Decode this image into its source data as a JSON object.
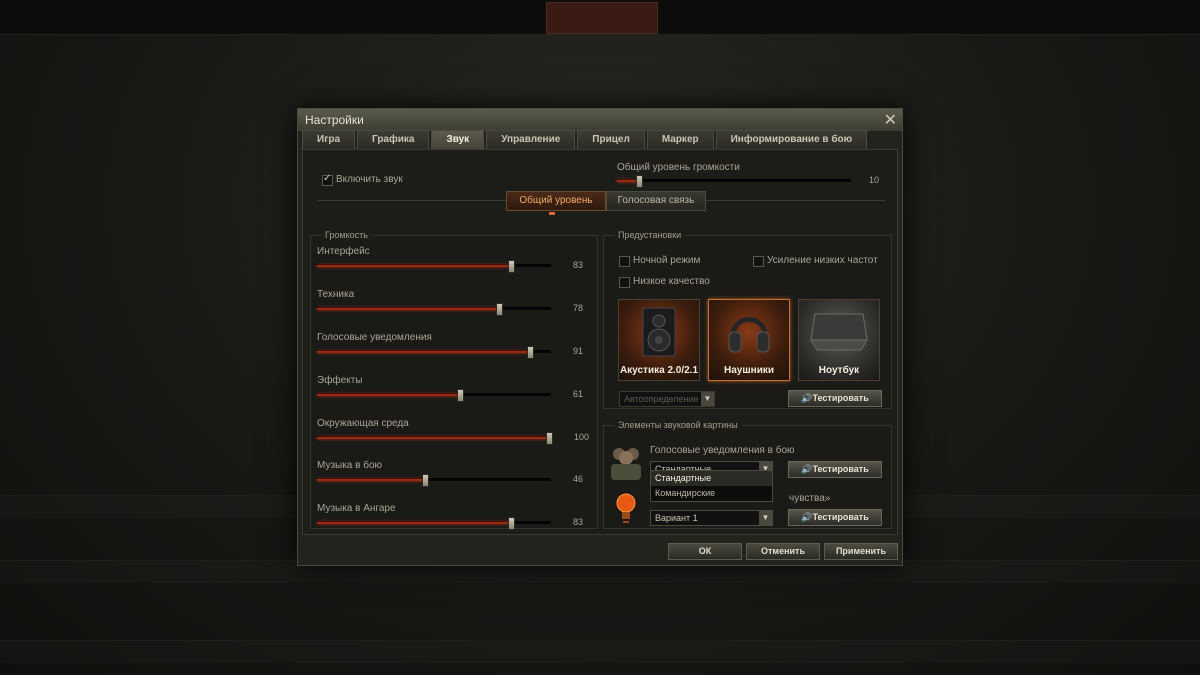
{
  "window": {
    "title": "Настройки"
  },
  "tabs": [
    {
      "label": "Игра"
    },
    {
      "label": "Графика"
    },
    {
      "label": "Звук"
    },
    {
      "label": "Управление"
    },
    {
      "label": "Прицел"
    },
    {
      "label": "Маркер"
    },
    {
      "label": "Информирование в бою"
    }
  ],
  "sound": {
    "enable_label": "Включить звук",
    "master_label": "Общий уровень громкости",
    "master_value": 10
  },
  "subtabs": [
    {
      "label": "Общий уровень"
    },
    {
      "label": "Голосовая связь"
    }
  ],
  "volume": {
    "title": "Громкость",
    "sliders": [
      {
        "label": "Интерфейс",
        "value": 83
      },
      {
        "label": "Техника",
        "value": 78
      },
      {
        "label": "Голосовые уведомления",
        "value": 91
      },
      {
        "label": "Эффекты",
        "value": 61
      },
      {
        "label": "Окружающая среда",
        "value": 100
      },
      {
        "label": "Музыка в бою",
        "value": 46
      },
      {
        "label": "Музыка в Ангаре",
        "value": 83
      }
    ]
  },
  "presets": {
    "title": "Предустановки",
    "night_mode": "Ночной режим",
    "bass_boost": "Усиление низких частот",
    "low_quality": "Низкое качество",
    "devices": [
      {
        "label": "Акустика 2.0/2.1"
      },
      {
        "label": "Наушники"
      },
      {
        "label": "Ноутбук"
      }
    ],
    "autodetect": "Автоопределение",
    "test": "Тестировать"
  },
  "elements": {
    "title": "Элементы звуковой картины",
    "voice_label": "Голосовые уведомления в бою",
    "voice_selected": "Стандартные",
    "voice_options": [
      "Стандартные",
      "Командирские"
    ],
    "sixth_sense_tail": "чувства»",
    "variant_selected": "Вариант 1",
    "test": "Тестировать"
  },
  "footer": {
    "ok": "ОК",
    "cancel": "Отменить",
    "apply": "Применить"
  }
}
